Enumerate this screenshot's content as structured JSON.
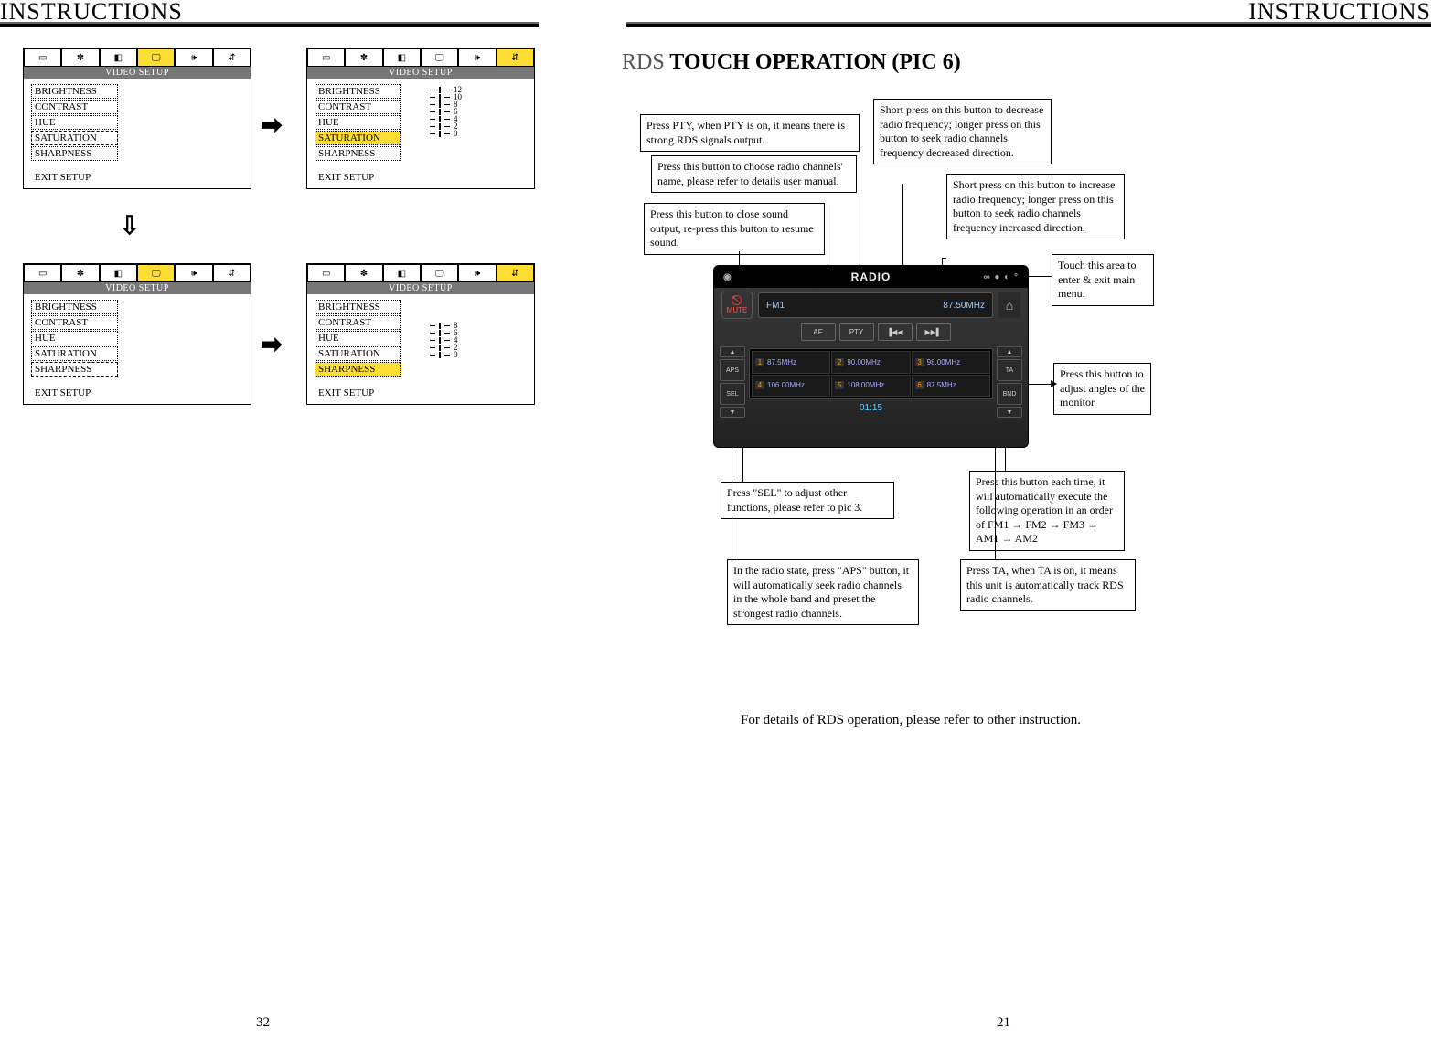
{
  "left_header": "INSTRUCTIONS",
  "right_header": "INSTRUCTIONS",
  "page_left": "32",
  "page_right": "21",
  "video": {
    "title": "VIDEO SETUP",
    "items": {
      "brightness": "BRIGHTNESS",
      "contrast": "CONTRAST",
      "hue": "HUE",
      "saturation": "SATURATION",
      "sharpness": "SHARPNESS"
    },
    "exit": "EXIT SETUP",
    "tabs": [
      "display-icon",
      "settings-icon",
      "color-icon",
      "monitor-icon",
      "speaker-icon",
      "adjust-icon"
    ]
  },
  "scales": {
    "saturation": [
      "12",
      "10",
      "8",
      "6",
      "4",
      "2",
      "0"
    ],
    "sharpness": [
      "8",
      "6",
      "4",
      "2",
      "0"
    ]
  },
  "rds": {
    "title_light": "RDS",
    "title_bold": " TOUCH OPERATION  (PIC 6)"
  },
  "callouts": {
    "pty": "Press PTY, when PTY is on, it means there is strong RDS signals output.",
    "af": "Press this button to choose radio channels' name, please refer to details user manual.",
    "mute": "Press this button to close sound output, re-press this button to resume sound.",
    "dec": "Short press on this button to decrease radio frequency; longer press on this button to seek radio channels frequency decreased direction.",
    "inc": "Short press on this button to increase radio frequency; longer press on this button to seek radio channels frequency increased direction.",
    "menu": "Touch this area to enter & exit main menu.",
    "angle": "Press this button to adjust angles of the monitor",
    "bnd": "Press this button each time, it will automatically execute the following operation in an order of FM1 → FM2 → FM3 →  AM1 → AM2",
    "ta": "Press TA, when TA is on, it means this unit is automatically track RDS radio channels.",
    "aps": "In the radio state, press \"APS\" button, it will automatically seek radio channels in the whole band and preset the strongest radio channels.",
    "sel": "Press \"SEL\" to adjust other functions, please refer to pic 3."
  },
  "device": {
    "brand": "RADIO",
    "band": "FM1",
    "freq": "87.50MHz",
    "btns": {
      "af": "AF",
      "pty": "PTY",
      "prev": "▐◀◀",
      "next": "▶▶▌"
    },
    "side_left": {
      "aps": "APS",
      "sel": "SEL"
    },
    "side_right": {
      "ta": "TA",
      "bnd": "BND"
    },
    "mute": "MUTE",
    "presets": [
      {
        "n": "1",
        "v": "87.5MHz"
      },
      {
        "n": "2",
        "v": "90.00MHz"
      },
      {
        "n": "3",
        "v": "98.00MHz"
      },
      {
        "n": "4",
        "v": "106.00MHz"
      },
      {
        "n": "5",
        "v": "108.00MHz"
      },
      {
        "n": "6",
        "v": "87.5MHz"
      }
    ],
    "clock": "01:15",
    "home": "⌂"
  },
  "footnote": "For details of RDS operation, please refer to other instruction."
}
